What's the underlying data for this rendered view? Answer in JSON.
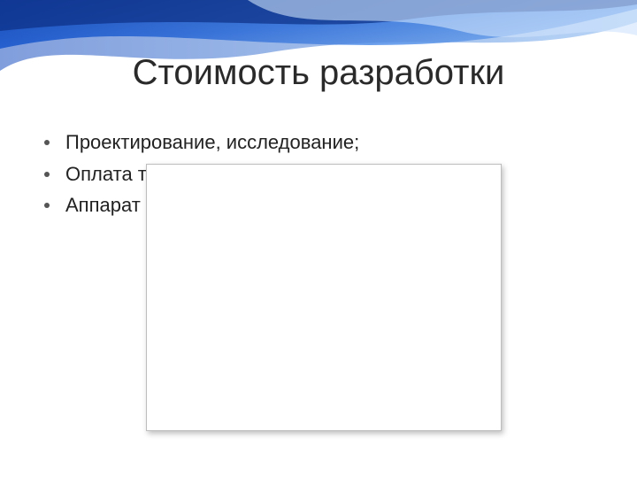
{
  "title": "Стоимость разработки",
  "bullets": [
    "Проектирование, исследование;",
    "Оплата труда разработчиков",
    "Аппарат"
  ]
}
